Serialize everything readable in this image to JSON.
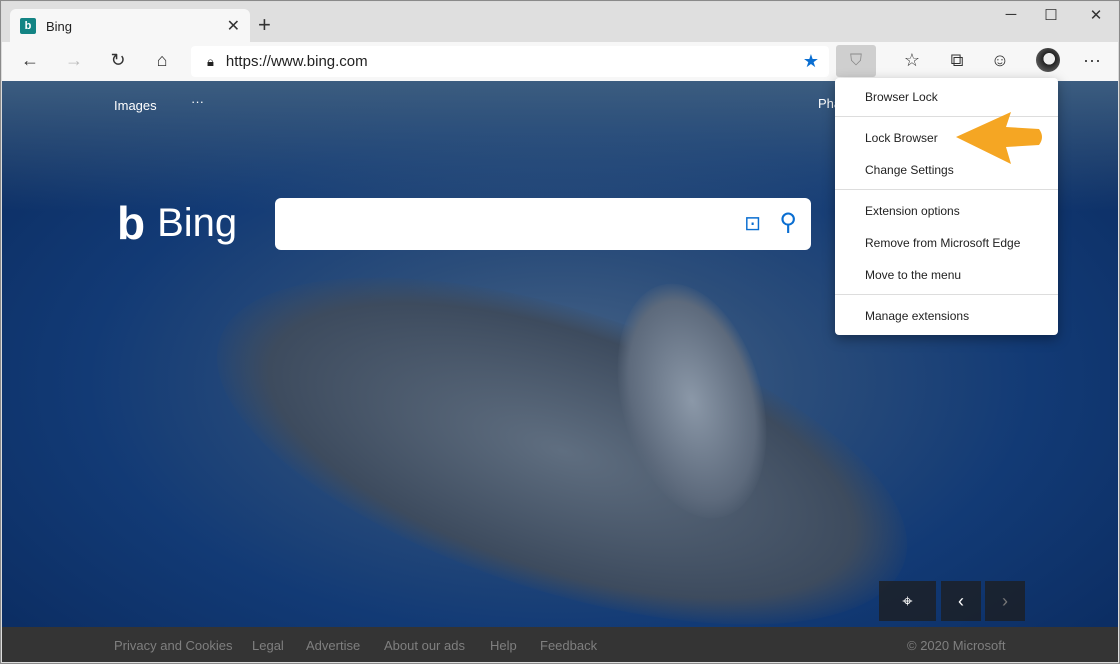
{
  "tab": {
    "title": "Bing",
    "logo": "b"
  },
  "window": {
    "minimize": "─",
    "maximize": "☐",
    "close": "✕",
    "new_tab": "+"
  },
  "toolbar": {
    "url": "https://www.bing.com"
  },
  "bing": {
    "nav_images": "Images",
    "nav_more": "···",
    "nav_partial": "Pha",
    "brand": "Bing",
    "brand_mark": "b"
  },
  "menu": {
    "header": "Browser Lock",
    "items": [
      "Lock Browser",
      "Change Settings",
      "Extension options",
      "Remove from Microsoft Edge",
      "Move to the menu",
      "Manage extensions"
    ]
  },
  "footer": {
    "links": [
      "Privacy and Cookies",
      "Legal",
      "Advertise",
      "About our ads",
      "Help",
      "Feedback"
    ],
    "copyright": "© 2020 Microsoft"
  },
  "colors": {
    "accent": "#0a6ed1",
    "arrow": "#f5a623",
    "footer_bg": "#343434"
  }
}
